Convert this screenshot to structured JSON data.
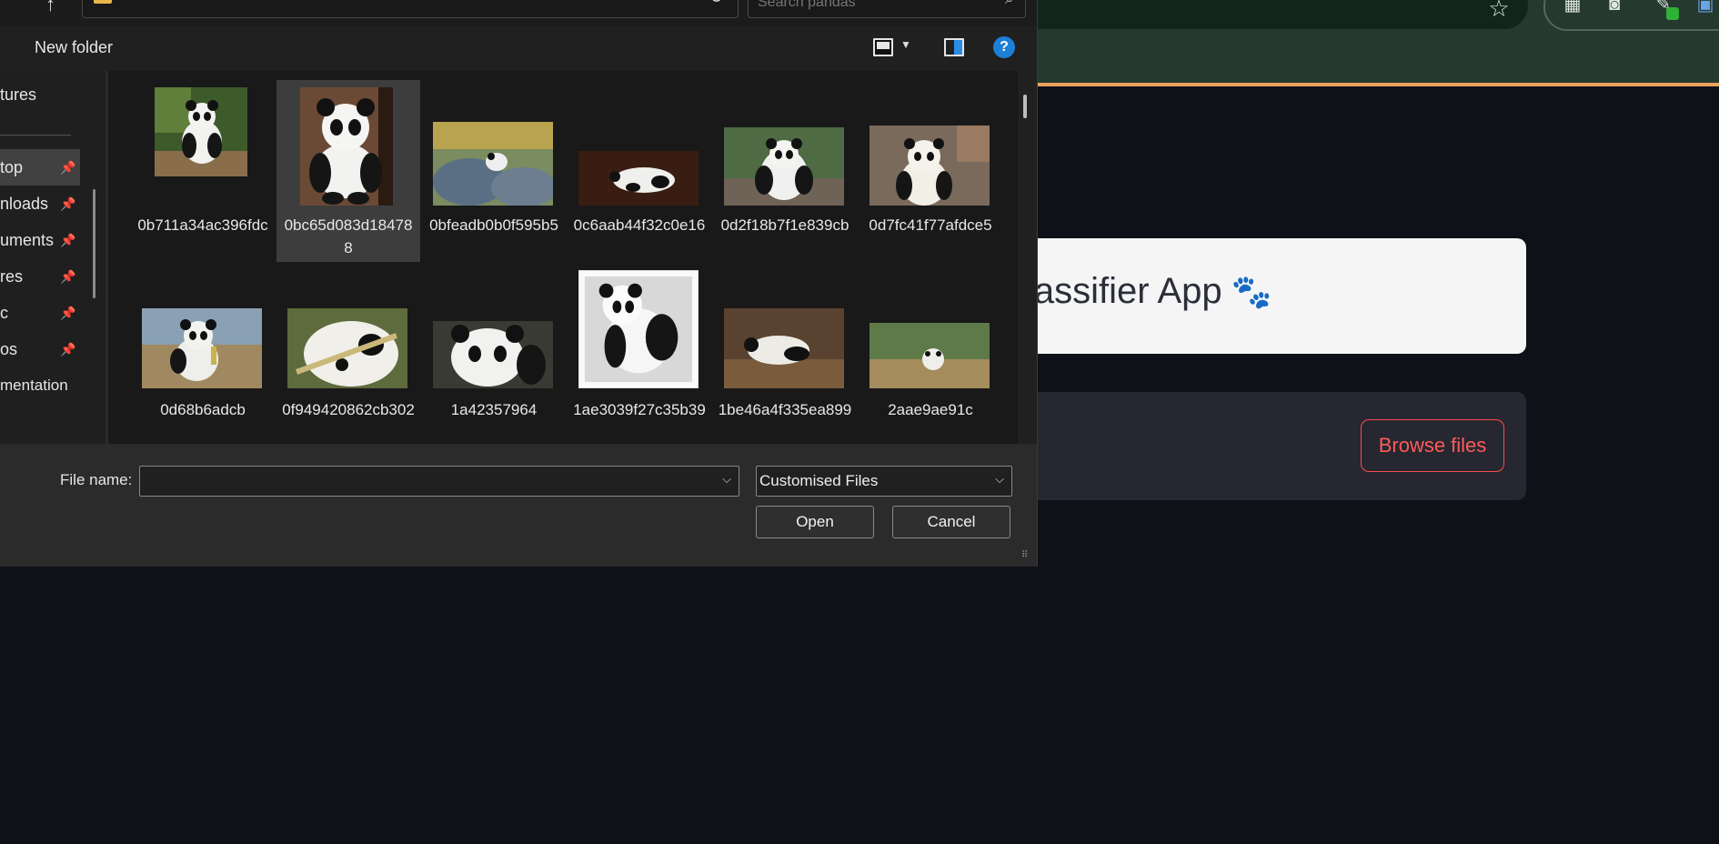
{
  "browser": {
    "star_icon": "star-icon",
    "extension_icons": [
      "tab-groups-icon",
      "camera-icon",
      "eyedropper-icon",
      "profile-icon"
    ],
    "colors": {
      "chrome_bg": "#25392e",
      "accent_line": "#e9a35c"
    }
  },
  "app": {
    "title": "lassifier App",
    "title_icon": "🐾",
    "browse_label": "Browse files",
    "colors": {
      "background": "#0e1117",
      "primary": "#ff4b4b"
    }
  },
  "dialog": {
    "search_placeholder": "Search pandas",
    "toolbar": {
      "new_folder_label": "New folder",
      "help_label": "?"
    },
    "nav_items": [
      {
        "label": "tures",
        "pinned": false,
        "selected": false
      },
      {
        "label": "top",
        "pinned": true,
        "selected": true
      },
      {
        "label": "nloads",
        "pinned": true,
        "selected": false
      },
      {
        "label": "uments",
        "pinned": true,
        "selected": false
      },
      {
        "label": "res",
        "pinned": true,
        "selected": false
      },
      {
        "label": "c",
        "pinned": true,
        "selected": false
      },
      {
        "label": "os",
        "pinned": true,
        "selected": false
      },
      {
        "label": "mentation",
        "pinned": false,
        "selected": false
      }
    ],
    "files": [
      "0b711a34ac396fdc",
      "0bc65d083d184788",
      "0bfeadb0b0f595b5",
      "0c6aab44f32c0e16",
      "0d2f18b7f1e839cb",
      "0d7fc41f77afdce5",
      "0d68b6adcb",
      "0f949420862cb302",
      "1a42357964",
      "1ae3039f27c35b39",
      "1be46a4f335ea899",
      "2aae9ae91c"
    ],
    "hovered_file": "0bc65d083d184788",
    "filename_label": "File name:",
    "filename_value": "",
    "filetype_value": "Customised Files",
    "open_label": "Open",
    "cancel_label": "Cancel"
  }
}
